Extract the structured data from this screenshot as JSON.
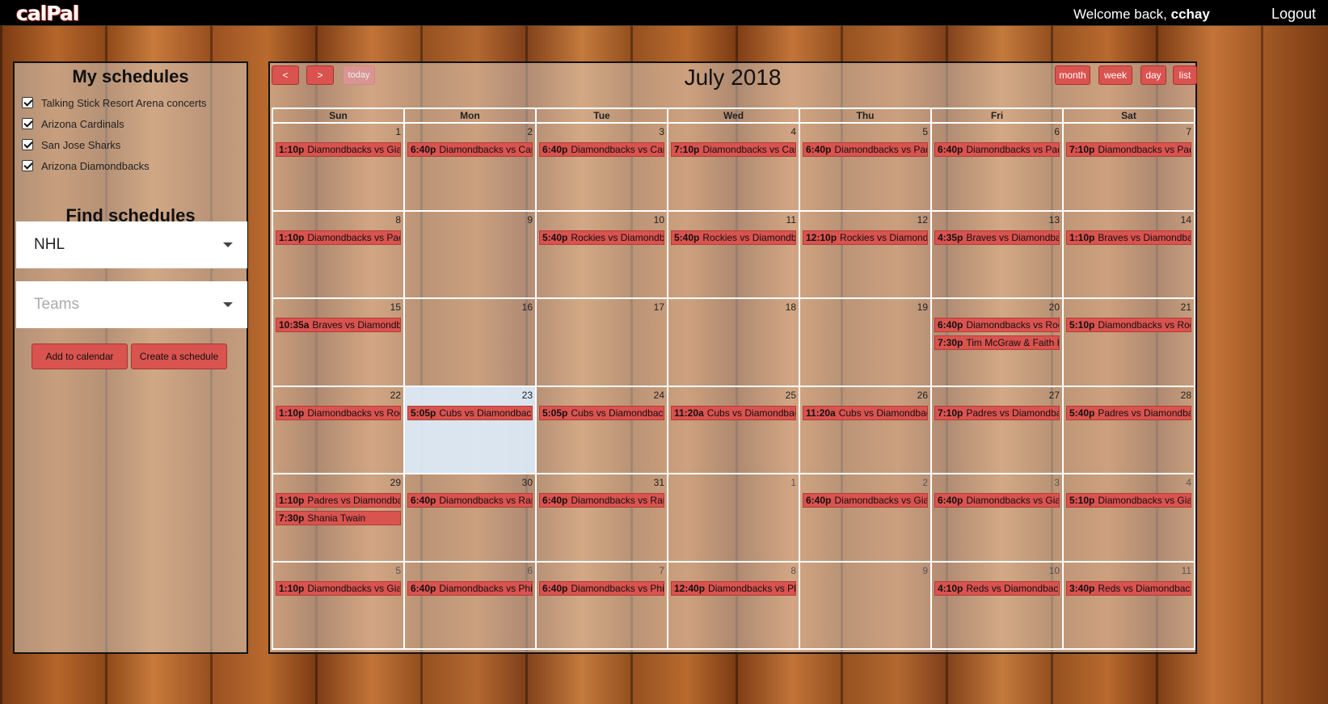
{
  "header": {
    "logo": "calPal",
    "welcome_prefix": "Welcome back,",
    "username": "cchay",
    "logout_label": "Logout"
  },
  "sidebar": {
    "my_title": "My schedules",
    "schedules": [
      {
        "label": "Talking Stick Resort Arena concerts",
        "checked": true
      },
      {
        "label": "Arizona Cardinals",
        "checked": true
      },
      {
        "label": "San Jose Sharks",
        "checked": true
      },
      {
        "label": "Arizona Diamondbacks",
        "checked": true
      }
    ],
    "find_title": "Find schedules",
    "league_value": "NHL",
    "teams_placeholder": "Teams",
    "add_label": "Add to calendar",
    "create_label": "Create a schedule"
  },
  "calendar": {
    "title": "July 2018",
    "prev_label": "<",
    "next_label": ">",
    "today_label": "today",
    "views": {
      "month": "month",
      "week": "week",
      "day": "day",
      "list": "list"
    },
    "weekdays": [
      "Sun",
      "Mon",
      "Tue",
      "Wed",
      "Thu",
      "Fri",
      "Sat"
    ],
    "weeks": [
      [
        {
          "num": "1",
          "events": [
            {
              "time": "1:10p",
              "title": "Diamondbacks vs Giants"
            }
          ]
        },
        {
          "num": "2",
          "events": [
            {
              "time": "6:40p",
              "title": "Diamondbacks vs Cardinals"
            }
          ]
        },
        {
          "num": "3",
          "events": [
            {
              "time": "6:40p",
              "title": "Diamondbacks vs Cardinals"
            }
          ]
        },
        {
          "num": "4",
          "events": [
            {
              "time": "7:10p",
              "title": "Diamondbacks vs Cardinals"
            }
          ]
        },
        {
          "num": "5",
          "events": [
            {
              "time": "6:40p",
              "title": "Diamondbacks vs Padres"
            }
          ]
        },
        {
          "num": "6",
          "events": [
            {
              "time": "6:40p",
              "title": "Diamondbacks vs Padres"
            }
          ]
        },
        {
          "num": "7",
          "events": [
            {
              "time": "7:10p",
              "title": "Diamondbacks vs Padres"
            }
          ]
        }
      ],
      [
        {
          "num": "8",
          "events": [
            {
              "time": "1:10p",
              "title": "Diamondbacks vs Padres"
            }
          ]
        },
        {
          "num": "9",
          "events": []
        },
        {
          "num": "10",
          "events": [
            {
              "time": "5:40p",
              "title": "Rockies vs Diamondbacks"
            }
          ]
        },
        {
          "num": "11",
          "events": [
            {
              "time": "5:40p",
              "title": "Rockies vs Diamondbacks"
            }
          ]
        },
        {
          "num": "12",
          "events": [
            {
              "time": "12:10p",
              "title": "Rockies vs Diamondbacks"
            }
          ]
        },
        {
          "num": "13",
          "events": [
            {
              "time": "4:35p",
              "title": "Braves vs Diamondbacks"
            }
          ]
        },
        {
          "num": "14",
          "events": [
            {
              "time": "1:10p",
              "title": "Braves vs Diamondbacks"
            }
          ]
        }
      ],
      [
        {
          "num": "15",
          "events": [
            {
              "time": "10:35a",
              "title": "Braves vs Diamondbacks"
            }
          ]
        },
        {
          "num": "16",
          "events": []
        },
        {
          "num": "17",
          "events": []
        },
        {
          "num": "18",
          "events": []
        },
        {
          "num": "19",
          "events": []
        },
        {
          "num": "20",
          "events": [
            {
              "time": "6:40p",
              "title": "Diamondbacks vs Rockies"
            },
            {
              "time": "7:30p",
              "title": "Tim McGraw & Faith Hill"
            }
          ]
        },
        {
          "num": "21",
          "events": [
            {
              "time": "5:10p",
              "title": "Diamondbacks vs Rockies"
            }
          ]
        }
      ],
      [
        {
          "num": "22",
          "events": [
            {
              "time": "1:10p",
              "title": "Diamondbacks vs Rockies"
            }
          ]
        },
        {
          "num": "23",
          "today": true,
          "events": [
            {
              "time": "5:05p",
              "title": "Cubs vs Diamondbacks"
            }
          ]
        },
        {
          "num": "24",
          "events": [
            {
              "time": "5:05p",
              "title": "Cubs vs Diamondbacks"
            }
          ]
        },
        {
          "num": "25",
          "events": [
            {
              "time": "11:20a",
              "title": "Cubs vs Diamondbacks"
            }
          ]
        },
        {
          "num": "26",
          "events": [
            {
              "time": "11:20a",
              "title": "Cubs vs Diamondbacks"
            }
          ]
        },
        {
          "num": "27",
          "events": [
            {
              "time": "7:10p",
              "title": "Padres vs Diamondbacks"
            }
          ]
        },
        {
          "num": "28",
          "events": [
            {
              "time": "5:40p",
              "title": "Padres vs Diamondbacks"
            }
          ]
        }
      ],
      [
        {
          "num": "29",
          "events": [
            {
              "time": "1:10p",
              "title": "Padres vs Diamondbacks"
            },
            {
              "time": "7:30p",
              "title": "Shania Twain"
            }
          ]
        },
        {
          "num": "30",
          "events": [
            {
              "time": "6:40p",
              "title": "Diamondbacks vs Rangers"
            }
          ]
        },
        {
          "num": "31",
          "events": [
            {
              "time": "6:40p",
              "title": "Diamondbacks vs Rangers"
            }
          ]
        },
        {
          "num": "1",
          "other": true,
          "events": []
        },
        {
          "num": "2",
          "other": true,
          "events": [
            {
              "time": "6:40p",
              "title": "Diamondbacks vs Giants"
            }
          ]
        },
        {
          "num": "3",
          "other": true,
          "events": [
            {
              "time": "6:40p",
              "title": "Diamondbacks vs Giants"
            }
          ]
        },
        {
          "num": "4",
          "other": true,
          "events": [
            {
              "time": "5:10p",
              "title": "Diamondbacks vs Giants"
            }
          ]
        }
      ],
      [
        {
          "num": "5",
          "other": true,
          "events": [
            {
              "time": "1:10p",
              "title": "Diamondbacks vs Giants"
            }
          ]
        },
        {
          "num": "6",
          "other": true,
          "events": [
            {
              "time": "6:40p",
              "title": "Diamondbacks vs Phillies"
            }
          ]
        },
        {
          "num": "7",
          "other": true,
          "events": [
            {
              "time": "6:40p",
              "title": "Diamondbacks vs Phillies"
            }
          ]
        },
        {
          "num": "8",
          "other": true,
          "events": [
            {
              "time": "12:40p",
              "title": "Diamondbacks vs Phillies"
            }
          ]
        },
        {
          "num": "9",
          "other": true,
          "events": []
        },
        {
          "num": "10",
          "other": true,
          "events": [
            {
              "time": "4:10p",
              "title": "Reds vs Diamondbacks"
            }
          ]
        },
        {
          "num": "11",
          "other": true,
          "events": [
            {
              "time": "3:40p",
              "title": "Reds vs Diamondbacks"
            }
          ]
        }
      ]
    ]
  }
}
